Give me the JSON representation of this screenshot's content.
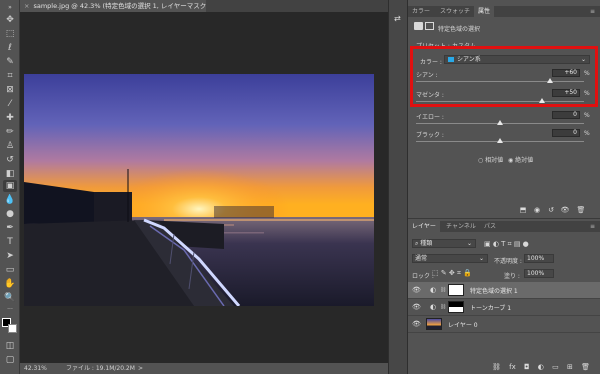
{
  "document": {
    "tab_close": "×",
    "tab_title": "sample.jpg @ 42.3% (特定色域の選択 1, レイヤーマスク/8) *"
  },
  "status": {
    "zoom": "42.31%",
    "file": "ファイル : 19.1M/20.2M",
    "arrow": ">"
  },
  "properties": {
    "tabs": [
      "カラー",
      "スウォッチ",
      "属性"
    ],
    "menu_icon": "≡",
    "header": "特定色域の選択",
    "preset_label": "プリセット :",
    "preset_value": "カスタム",
    "color_label": "カラー :",
    "color_value": "シアン系",
    "color_swatch": "#29a9e8",
    "sliders": [
      {
        "label": "シアン :",
        "value": "+60",
        "unit": "%",
        "pct": 60
      },
      {
        "label": "マゼンタ :",
        "value": "+50",
        "unit": "%",
        "pct": 50
      },
      {
        "label": "イエロー :",
        "value": "0",
        "unit": "%",
        "pct": 0
      },
      {
        "label": "ブラック :",
        "value": "0",
        "unit": "%",
        "pct": 0
      }
    ],
    "method_relative": "相対値",
    "method_absolute": "絶対値",
    "method_selected": "absolute"
  },
  "layers": {
    "tabs": [
      "レイヤー",
      "チャンネル",
      "パス"
    ],
    "menu_icon": "≡",
    "filter_kind": "種類",
    "blend_mode": "通常",
    "opacity_label": "不透明度 :",
    "opacity_value": "100%",
    "lock_label": "ロック :",
    "fill_label": "塗り :",
    "fill_value": "100%",
    "items": [
      {
        "name": "特定色域の選択 1",
        "selected": true,
        "type": "adjustment-selective-color"
      },
      {
        "name": "トーンカーブ 1",
        "selected": false,
        "type": "adjustment-curves"
      },
      {
        "name": "レイヤー 0",
        "selected": false,
        "type": "image"
      }
    ],
    "footer_icons": [
      "link-icon",
      "fx-icon",
      "mask-icon",
      "adjustment-icon",
      "folder-icon",
      "new-layer-icon",
      "trash-icon"
    ]
  },
  "accent_colors": {
    "highlight_box": "#e01010",
    "selected_layer": "#6a6a6a"
  }
}
